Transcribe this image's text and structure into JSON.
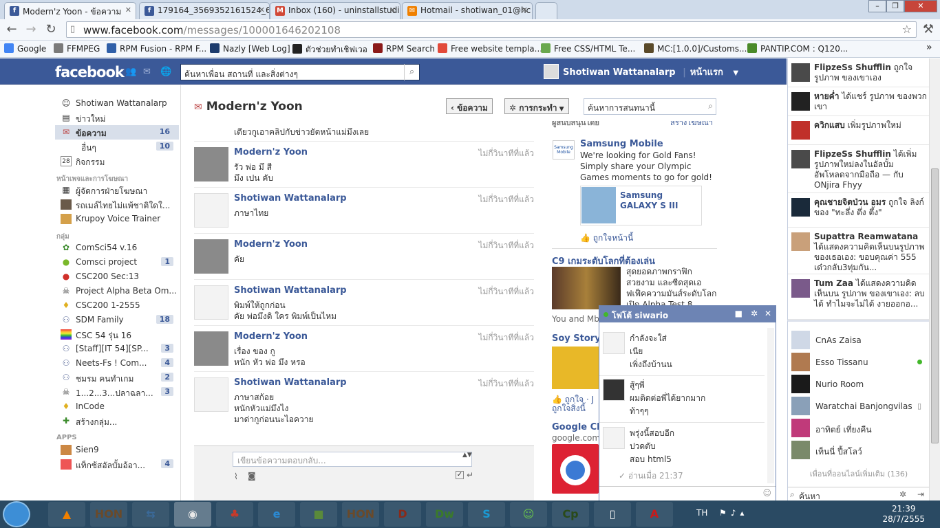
{
  "browser": {
    "tabs": [
      {
        "title": "Modern'z Yoon - ข้อความ",
        "icon": "facebook-icon",
        "color": "#3b5998"
      },
      {
        "title": "179164_3569352161524_625",
        "icon": "facebook-icon",
        "color": "#3b5998"
      },
      {
        "title": "Inbox (160) - uninstallstudi",
        "icon": "gmail-icon",
        "color": "#d14836"
      },
      {
        "title": "Hotmail - shotiwan_01@hc",
        "icon": "hotmail-icon",
        "color": "#f08000"
      }
    ],
    "url_host": "www.facebook.com",
    "url_path": "/messages/100001646202108",
    "bookmarks": [
      "Google",
      "FFMPEG",
      "RPM Fusion - RPM F...",
      "Nazly [Web Log]",
      "ตัวช่วยทำเชิฟเวอ",
      "RPM Search",
      "Free website templa...",
      "Free CSS/HTML Te...",
      "MC:[1.0.0]/Customs...",
      "PANTIP.COM : Q120..."
    ]
  },
  "fb": {
    "logo": "facebook",
    "search_placeholder": "ค้นหาเพื่อน สถานที่ และสิ่งต่างๆ",
    "user_name": "Shotiwan Wattanalarp",
    "home": "หน้าแรก"
  },
  "leftnav": {
    "top": [
      {
        "label": "Shotiwan Wattanalarp",
        "icon": "profile-icon",
        "count": ""
      },
      {
        "label": "ข่าวใหม่",
        "icon": "newsfeed-icon",
        "count": ""
      },
      {
        "label": "ข้อความ",
        "icon": "messages-icon",
        "count": "16"
      },
      {
        "label": "อื่นๆ",
        "icon": "",
        "count": "10"
      },
      {
        "label": "กิจกรรม",
        "icon": "events-icon",
        "count": ""
      }
    ],
    "pages_header": "หน้าเพจและการโฆษณา",
    "pages": [
      {
        "label": "ผู้จัดการฝ่ายโฆษณา",
        "icon": "ads-manager-icon",
        "count": ""
      },
      {
        "label": "รถเมล์ไทยไม่แพ้ชาติใดใ...",
        "icon": "page-icon",
        "count": ""
      },
      {
        "label": "Krupoy Voice Trainer",
        "icon": "page-icon",
        "count": ""
      }
    ],
    "groups_header": "กลุ่ม",
    "groups": [
      {
        "label": "ComSci54    v.16",
        "icon": "plant-icon",
        "count": ""
      },
      {
        "label": "Comsci project",
        "icon": "apple-icon",
        "count": "1"
      },
      {
        "label": "CSC200 Sec:13",
        "icon": "apple-icon",
        "count": ""
      },
      {
        "label": "Project Alpha Beta Om...",
        "icon": "skull-icon",
        "count": ""
      },
      {
        "label": "CSC200 1-2555",
        "icon": "bulb-icon",
        "count": ""
      },
      {
        "label": "SDM Family",
        "icon": "group-icon",
        "count": "18"
      },
      {
        "label": "CSC 54 รุ่น 16",
        "icon": "rainbow-flag-icon",
        "count": ""
      },
      {
        "label": "[Staff][IT 54][SP...",
        "icon": "group-icon",
        "count": "3"
      },
      {
        "label": "Neets-Fs ! Com...",
        "icon": "group-icon",
        "count": "4"
      },
      {
        "label": "ชมรม คนทำเกม",
        "icon": "group-icon",
        "count": "2"
      },
      {
        "label": "1...2...3...ปลาฉลา...",
        "icon": "skull-icon",
        "count": "3"
      },
      {
        "label": "InCode",
        "icon": "bulb-icon",
        "count": ""
      },
      {
        "label": "สร้างกลุ่ม...",
        "icon": "create-group-icon",
        "count": ""
      }
    ],
    "apps_header": "APPS",
    "apps": [
      {
        "label": "Sien9",
        "icon": "app-icon",
        "count": ""
      },
      {
        "label": "แท็กซ้สอัลบั้มอ้อา...",
        "icon": "app-icon",
        "count": "4"
      }
    ]
  },
  "thread": {
    "title": "Modern'z Yoon",
    "back_btn": "ข้อความ",
    "actions_btn": "การกระทำ",
    "search_placeholder": "ค้นหาการสนทนานี้",
    "first_line": "เดียวกูเอาคลิปกับข่าวยัดหน้าแม่มึงเลย",
    "messages": [
      {
        "name": "Modern'z Yoon",
        "time": "ไม่กี่วินาทีที่แล้ว",
        "text": "รัว พ่อ มึ สี\nมึง เปน คับ",
        "me": false
      },
      {
        "name": "Shotiwan Wattanalarp",
        "time": "ไม่กี่วินาทีที่แล้ว",
        "text": "ภาษาไทย",
        "me": true
      },
      {
        "name": "Modern'z Yoon",
        "time": "ไม่กี่วินาทีที่แล้ว",
        "text": "คัย",
        "me": false
      },
      {
        "name": "Shotiwan Wattanalarp",
        "time": "ไม่กี่วินาทีที่แล้ว",
        "text": "พิมพ์ให้ถูกก่อน\nคัย พ่อมึงดิ ใคร พิมพ์เป็นไหม",
        "me": true
      },
      {
        "name": "Modern'z Yoon",
        "time": "ไม่กี่วินาทีที่แล้ว",
        "text": "เรื่อง ของ กู\nหนัก หัว พ่อ มึง หรอ",
        "me": false
      },
      {
        "name": "Shotiwan Wattanalarp",
        "time": "ไม่กี่วินาทีที่แล้ว",
        "text": "ภาษาสก้อย\nหนักหัวแม่มึงไง\nมาด่ากูก่อนนะไอควาย",
        "me": true
      }
    ],
    "reply_placeholder": "เขียนข้อความตอบกลับ..."
  },
  "ads": {
    "cut_header": "ผู้สนับสนุนโดย",
    "cut_header_right": "สร้างโฆษณา",
    "samsung_title": "Samsung Mobile",
    "samsung_text": "We're looking for Gold Fans!\nSimply share your Olympic\nGames moments to go for gold!",
    "samsung_product": "Samsung\nGALAXY S III",
    "samsung_logo": "Samsung\nMobile",
    "like_page": "ถูกใจหน้านี้",
    "c9_title": "C9 เกมระดับโลกที่ต้องเล่น",
    "c9_text": "สุดยอดภาพกราฟิก\nสวยงาม และซีดสุดเอ\nฟเฟ็คความมันส์ระดับโลก\nเปิด Alpha Test 8",
    "c9_more": "You and Mb",
    "soy_title": "Soy Story",
    "soy_like": "ถูกใจ · J",
    "soy_like2": "ถูกใจสิ่งนี้",
    "google_title": "Google Chr",
    "google_url": "google.com"
  },
  "ticker": [
    {
      "name": "FlipzeSs Shufflin",
      "text": " ถูกใจรูปภาพ ของเขาเอง"
    },
    {
      "name": "หายค่ำ",
      "text": " ได้แชร์ รูปภาพ ของพวกเขา"
    },
    {
      "name": "ควิกแสบ",
      "text": " เพิ่มรูปภาพใหม่"
    },
    {
      "name": "FlipzeSs Shufflin",
      "text": " ได้เพิ่มรูปภาพใหม่ลงในอัลบั้ม อัพโหลดจากมือถือ — กับ ONjira Fhyy"
    },
    {
      "name": "คุณชายจิตป่วน อมร",
      "text": " ถูกใจ ลิงก์ ของ \"ทะลึ่ง ตึ่ง ตึ้ง\""
    },
    {
      "name": "Supattra Reamwatana",
      "text": " ได้แสดงความคิดเห็นบนรูปภาพ ของเธอเอง: ขอบคุณค่า 555 เด๋วกลับ3ทุ่มกัน..."
    },
    {
      "name": "Tum Zaa",
      "text": " ได้แสดงความคิดเห็นบน รูปภาพ ของเขาเอง: ลบได้ ทำไมจะไม่ได้ งายออกอ..."
    }
  ],
  "online": [
    {
      "name": "CnAs Zaisa",
      "status": ""
    },
    {
      "name": "Esso Tissanu",
      "status": "online"
    },
    {
      "name": "Nurio Room",
      "status": ""
    },
    {
      "name": "Waratchai Banjongvilas",
      "status": "mobile"
    },
    {
      "name": "อาทิตย์ เที่ยงคืน",
      "status": ""
    },
    {
      "name": "เท็นนี่ ปี้สโลว์",
      "status": ""
    }
  ],
  "more_online": "เพื่อนที่ออนไลน์เพิ่มเติม (136)",
  "sidebar_search": "ค้นหา",
  "chat": {
    "title": "โฟโต้ siwario",
    "blocks": [
      {
        "text": "กำลังจะใส่\nเนีย\nเพิ่งถึงบ้านน",
        "dark": false
      },
      {
        "text": "สู้ๆพี่\nผมติดต่อพี่ได้ยากมาก\nท้าๆๆ",
        "dark": true
      },
      {
        "text": "พรุ่งนี้สอบอีก\nปวดตับ\nสอบ html5",
        "dark": false
      }
    ],
    "seen": "อ่านเมื่อ 21:37"
  },
  "taskbar": {
    "lang": "TH",
    "time": "21:39",
    "date": "28/7/2555",
    "apps": [
      "vlc-icon",
      "hon-icon",
      "network-icon",
      "chrome-icon",
      "acer-icon",
      "ie-icon",
      "minecraft-icon",
      "hon2-icon",
      "diablo-icon",
      "dreamweaver-icon",
      "skype-icon",
      "people-icon",
      "captivate-icon",
      "notepad-icon",
      "adobe-reader-icon"
    ],
    "app_labels": [
      "▲",
      "HON",
      "⇆",
      "◉",
      "♣",
      "e",
      "■",
      "HON",
      "D",
      "Dw",
      "S",
      "☺",
      "Cp",
      "▯",
      "A"
    ]
  }
}
